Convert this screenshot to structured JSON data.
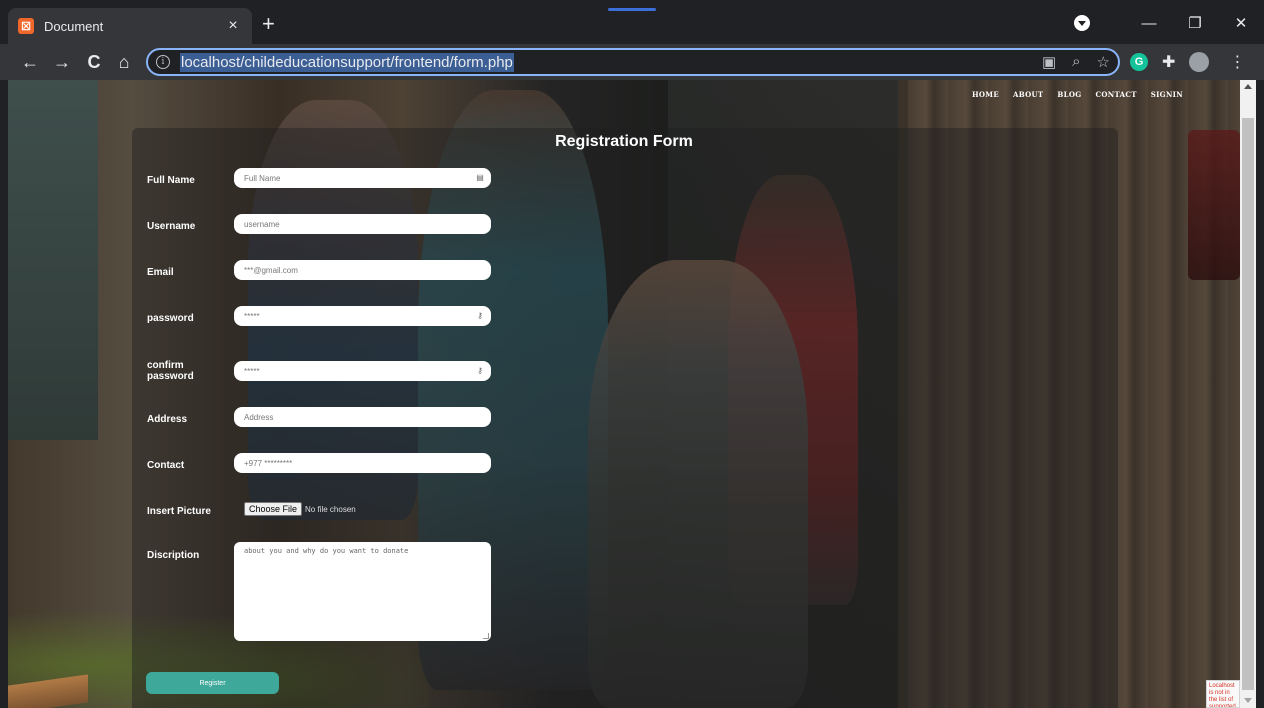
{
  "browser": {
    "tab_title": "Document",
    "tab_close": "×",
    "new_tab": "+",
    "url": "localhost/childeducationsupport/frontend/form.php",
    "nav": {
      "back": "←",
      "forward": "→",
      "reload": "C",
      "home": "⌂"
    },
    "window_controls": {
      "minimize": "—",
      "restore": "❐",
      "close": "✕"
    },
    "extensions": {
      "grammarly": "G"
    },
    "omnibox_icons": [
      "qr-code-icon",
      "zoom-icon",
      "star-icon"
    ]
  },
  "site_nav": [
    "HOME",
    "ABOUT",
    "BLOG",
    "CONTACT",
    "SIGNIN"
  ],
  "form": {
    "title": "Registration Form",
    "full_name": {
      "label": "Full Name",
      "placeholder": "Full Name"
    },
    "username": {
      "label": "Username",
      "placeholder": "username"
    },
    "email": {
      "label": "Email",
      "placeholder": "***@gmail.com"
    },
    "password": {
      "label": "password",
      "placeholder": "*****"
    },
    "confirm_password": {
      "label": "confirm password",
      "placeholder": "*****"
    },
    "address": {
      "label": "Address",
      "placeholder": "Address"
    },
    "contact": {
      "label": "Contact",
      "placeholder": "+977 *********"
    },
    "picture": {
      "label": "Insert Picture",
      "button": "Choose File",
      "status": "No file chosen"
    },
    "description": {
      "label": "Discription",
      "placeholder": "about you and why do you want to donate"
    },
    "submit": "Register"
  },
  "recaptcha_text": "Localhost is not in the list of supported domains for this site key."
}
